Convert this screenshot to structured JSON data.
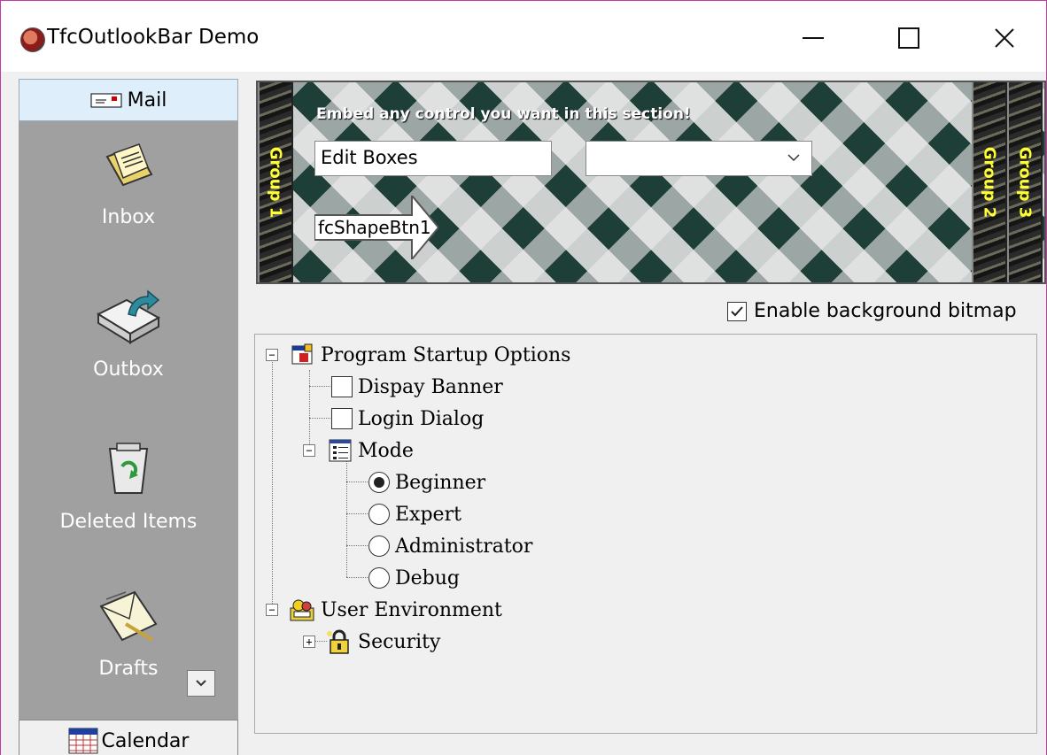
{
  "window": {
    "title": "TfcOutlookBar Demo",
    "minimize_glyph": "—",
    "maximize_glyph": "☐",
    "close_glyph": "✕"
  },
  "outlook_bar": {
    "top_group": "Mail",
    "items": [
      {
        "label": "Inbox",
        "icon": "inbox-icon"
      },
      {
        "label": "Outbox",
        "icon": "outbox-icon"
      },
      {
        "label": "Deleted Items",
        "icon": "recycle-bin-icon"
      },
      {
        "label": "Drafts",
        "icon": "drafts-icon"
      }
    ],
    "bottom_group": "Calendar"
  },
  "banner": {
    "caption": "Embed any control you want in this section!",
    "edit_value": "Edit Boxes",
    "combo_value": "",
    "shape_button_label": "fcShapeBtn1",
    "groups": [
      "Group 1",
      "Group 2",
      "Group 3"
    ]
  },
  "enable_bitmap": {
    "label": "Enable background bitmap",
    "checked": true
  },
  "tree": {
    "program_startup": "Program Startup Options",
    "display_banner": "Dispay Banner",
    "login_dialog": "Login Dialog",
    "mode": "Mode",
    "beginner": "Beginner",
    "expert": "Expert",
    "administrator": "Administrator",
    "debug": "Debug",
    "user_environment": "User Environment",
    "security": "Security",
    "selected_mode": "Beginner"
  },
  "colors": {
    "window_border": "#c239a6",
    "outlook_bar_bg": "#a0a0a0",
    "group_text": "#ffff33",
    "selected_header_bg": "#dfeefb"
  }
}
